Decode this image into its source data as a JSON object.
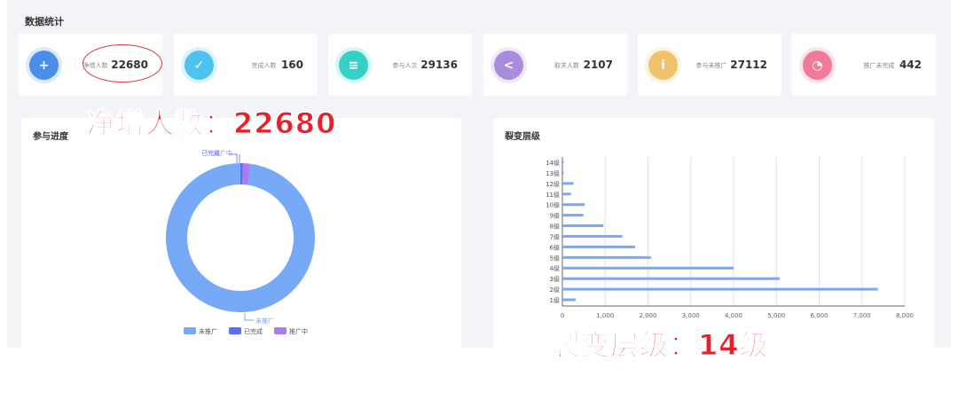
{
  "section_title": "数据统计",
  "cards": [
    {
      "label": "净增人数",
      "value": "22680",
      "icon": "add-user-icon",
      "color": "#4a8fe7",
      "glyph": "+"
    },
    {
      "label": "完成人数",
      "value": "160",
      "icon": "check-circle-icon",
      "color": "#4fc3f0",
      "glyph": "✓"
    },
    {
      "label": "参与人次",
      "value": "29136",
      "icon": "group-icon",
      "color": "#36d0c6",
      "glyph": "≡"
    },
    {
      "label": "取关人数",
      "value": "2107",
      "icon": "share-icon",
      "color": "#a98be0",
      "glyph": "<"
    },
    {
      "label": "参与未推广",
      "value": "27112",
      "icon": "info-icon",
      "color": "#f0c26a",
      "glyph": "i"
    },
    {
      "label": "推广未完成",
      "value": "442",
      "icon": "pie-icon",
      "color": "#f07a98",
      "glyph": "◔"
    }
  ],
  "annotations": {
    "net_growth": "净增人数：22680",
    "levels": "裂变层级：14级"
  },
  "chart_data": [
    {
      "type": "pie",
      "title": "参与进度",
      "labels": [
        "未推广",
        "已完成",
        "推广中"
      ],
      "values": [
        27112,
        160,
        442
      ],
      "colors": [
        "#76a9f8",
        "#5b6ef0",
        "#a97cf2"
      ],
      "slice_labels": [
        "未推广",
        "已完成",
        "推广中"
      ],
      "legend": "bottom"
    },
    {
      "type": "bar",
      "orientation": "horizontal",
      "title": "裂变层级",
      "categories": [
        "1级",
        "2级",
        "3级",
        "4级",
        "5级",
        "6级",
        "7级",
        "8级",
        "9级",
        "10级",
        "11级",
        "12级",
        "13级",
        "14级"
      ],
      "values": [
        310,
        7370,
        5080,
        4000,
        2070,
        1700,
        1400,
        960,
        490,
        520,
        200,
        260,
        30,
        30
      ],
      "xlim": [
        0,
        8000
      ],
      "xticks": [
        "0",
        "1,000",
        "2,000",
        "3,000",
        "4,000",
        "5,000",
        "6,000",
        "7,000",
        "8,000"
      ],
      "color": "#76a9f8",
      "grid": true
    }
  ]
}
